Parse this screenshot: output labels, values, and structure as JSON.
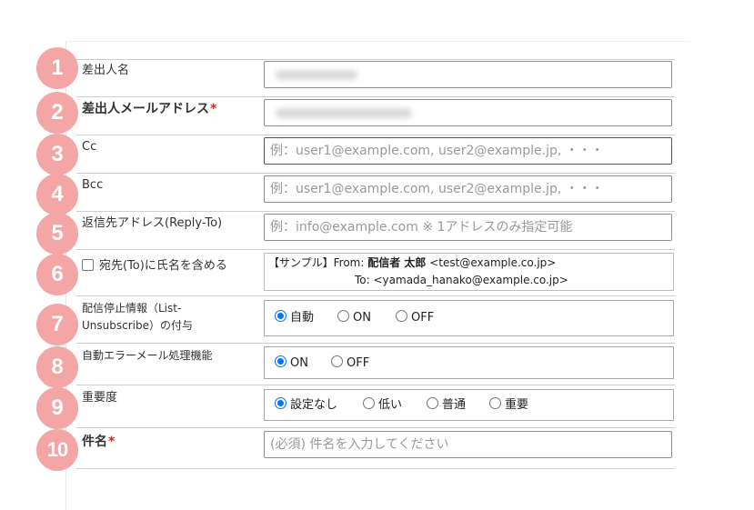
{
  "badges": [
    "1",
    "2",
    "3",
    "4",
    "5",
    "6",
    "7",
    "8",
    "9",
    "10"
  ],
  "rows": {
    "sender_name": {
      "label": "差出人名"
    },
    "sender_email": {
      "label": "差出人メールアドレス",
      "required_mark": "*"
    },
    "cc": {
      "label": "Cc",
      "placeholder": "例：user1@example.com, user2@example.jp, ・・・"
    },
    "bcc": {
      "label": "Bcc",
      "placeholder": "例：user1@example.com, user2@example.jp, ・・・"
    },
    "reply_to": {
      "label": "返信先アドレス(Reply-To)",
      "placeholder": "例：info@example.com ※ 1アドレスのみ指定可能"
    },
    "to_name": {
      "checkbox_label": "宛先(To)に氏名を含める",
      "checked": false,
      "sample_prefix": "【サンプル】From: ",
      "sample_from_name": "配信者 太郎",
      "sample_from_addr": " <test@example.co.jp>",
      "sample_to": "To: <yamada_hanako@example.co.jp>"
    },
    "list_unsubscribe": {
      "label_line1": "配信停止情報（List-",
      "label_line2": "Unsubscribe）の付与",
      "options": [
        "自動",
        "ON",
        "OFF"
      ],
      "selected": "自動"
    },
    "auto_error": {
      "label": "自動エラーメール処理機能",
      "options": [
        "ON",
        "OFF"
      ],
      "selected": "ON"
    },
    "priority": {
      "label": "重要度",
      "options": [
        "設定なし",
        "低い",
        "普通",
        "重要"
      ],
      "selected": "設定なし"
    },
    "subject": {
      "label": "件名",
      "required_mark": "*",
      "placeholder": "(必須) 件名を入力してください"
    }
  },
  "colors": {
    "badge": "#f4a5a5",
    "required": "#e02020",
    "radio_accent": "#0075ff"
  }
}
